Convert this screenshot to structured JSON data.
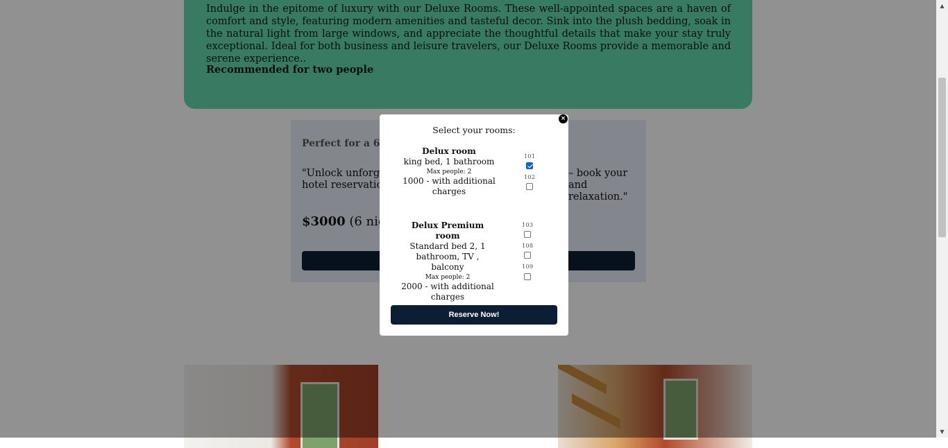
{
  "description": {
    "text": "Indulge in the epitome of luxury with our Deluxe Rooms. These well-appointed spaces are a haven of comfort and style, featuring modern amenities and tasteful decor. Sink into the plush bedding, soak in the natural light from large windows, and appreciate the thoughtful details that make your stay truly exceptional. Ideal for both business and leisure travelers, our Deluxe Rooms provide a memorable and serene experience..",
    "recommendation": "Recommended for two people"
  },
  "booking": {
    "heading": "Perfect for a 6-nig",
    "quote_left": "\"Unlock unforgettal",
    "quote_left2": "hotel reservation to",
    "quote_right": "– book your",
    "quote_right2": "and relaxation.\"",
    "price": "$3000",
    "nights": "(6 night"
  },
  "modal": {
    "close_symbol": "×",
    "title": "Select your rooms:",
    "rooms": [
      {
        "name": "Delux room",
        "details": "king bed, 1 bathroom",
        "max_people": "Max people: 2",
        "price_note": "1000 - with additional charges",
        "units": [
          {
            "number": "101",
            "checked": true
          },
          {
            "number": "102",
            "checked": false
          }
        ]
      },
      {
        "name": "Delux Premium room",
        "details": "Standard bed 2, 1 bathroom, TV , balcony",
        "max_people": "Max people: 2",
        "price_note": "2000 - with additional charges",
        "units": [
          {
            "number": "103",
            "checked": false
          },
          {
            "number": "108",
            "checked": false
          },
          {
            "number": "109",
            "checked": false
          }
        ]
      }
    ],
    "reserve_label": "Reserve Now!"
  },
  "colors": {
    "desc_card": "#65d9ac",
    "booking_bg": "#e6eef8",
    "button_dark": "#0c1e33",
    "checkbox_checked": "#0b63ce"
  },
  "icons": {
    "close": "close-icon",
    "scroll_up": "chevron-up-icon",
    "scroll_down": "chevron-down-icon"
  }
}
